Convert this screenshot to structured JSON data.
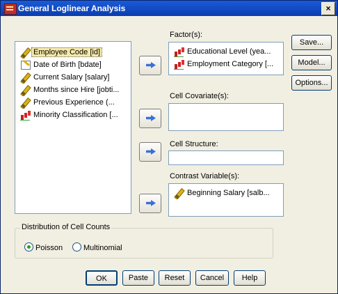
{
  "window": {
    "title": "General Loglinear Analysis",
    "close_label": "×"
  },
  "source_list": {
    "items": [
      {
        "label": "Employee Code [id]",
        "icon": "scale-icon",
        "selected": true
      },
      {
        "label": "Date of Birth [bdate]",
        "icon": "date-icon",
        "selected": false
      },
      {
        "label": "Current Salary [salary]",
        "icon": "scale-icon",
        "selected": false
      },
      {
        "label": "Months since Hire [jobti...",
        "icon": "scale-icon",
        "selected": false
      },
      {
        "label": "Previous Experience (...",
        "icon": "scale-icon",
        "selected": false
      },
      {
        "label": "Minority Classification [...",
        "icon": "nominal-icon",
        "selected": false
      }
    ]
  },
  "factors": {
    "label": "Factor(s):",
    "items": [
      {
        "label": "Educational Level (yea...",
        "icon": "nominal-icon"
      },
      {
        "label": "Employment Category [...",
        "icon": "nominal-icon"
      }
    ]
  },
  "covariates": {
    "label": "Cell Covariate(s):"
  },
  "cell_structure": {
    "label": "Cell Structure:",
    "value": ""
  },
  "contrast": {
    "label": "Contrast Variable(s):",
    "items": [
      {
        "label": "Beginning Salary [salb...",
        "icon": "scale-icon"
      }
    ]
  },
  "side_buttons": {
    "save": "Save...",
    "model": "Model...",
    "options": "Options..."
  },
  "distribution": {
    "title": "Distribution of Cell Counts",
    "options": [
      {
        "label": "Poisson",
        "checked": true
      },
      {
        "label": "Multinomial",
        "checked": false
      }
    ]
  },
  "bottom_buttons": {
    "ok": "OK",
    "paste": "Paste",
    "reset": "Reset",
    "cancel": "Cancel",
    "help": "Help"
  }
}
